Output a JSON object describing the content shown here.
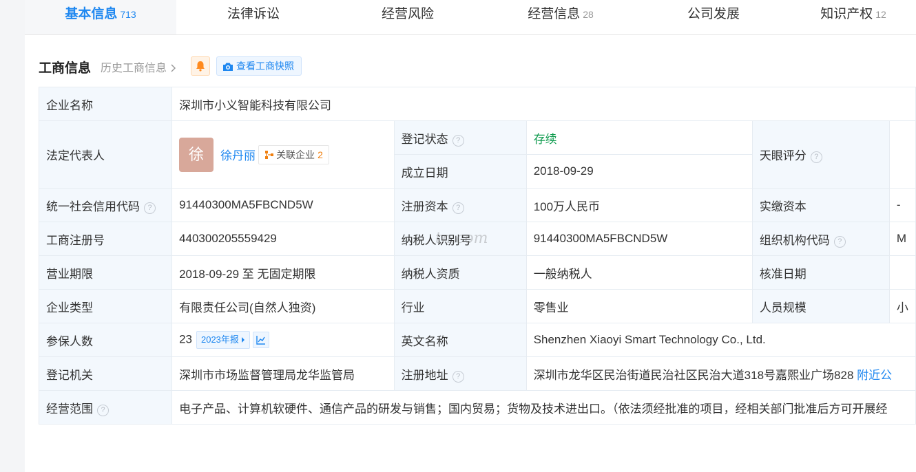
{
  "tabs": [
    {
      "label": "基本信息",
      "count": "713"
    },
    {
      "label": "法律诉讼",
      "count": ""
    },
    {
      "label": "经营风险",
      "count": ""
    },
    {
      "label": "经营信息",
      "count": "28"
    },
    {
      "label": "公司发展",
      "count": ""
    },
    {
      "label": "知识产权",
      "count": "12"
    }
  ],
  "section": {
    "title": "工商信息",
    "history_link": "历史工商信息",
    "snapshot_button": "查看工商快照"
  },
  "company": {
    "name_label": "企业名称",
    "name": "深圳市小义智能科技有限公司",
    "legal_rep_label": "法定代表人",
    "avatar_char": "徐",
    "legal_rep": "徐丹丽",
    "related_label": "关联企业",
    "related_count": "2",
    "status_label": "登记状态",
    "status": "存续",
    "founded_label": "成立日期",
    "founded": "2018-09-29",
    "score_label": "天眼评分",
    "credit_code_label": "统一社会信用代码",
    "credit_code": "91440300MA5FBCND5W",
    "reg_capital_label": "注册资本",
    "reg_capital": "100万人民币",
    "paid_capital_label": "实缴资本",
    "paid_capital": "-",
    "reg_no_label": "工商注册号",
    "reg_no": "440300205559429",
    "taxpayer_id_label": "纳税人识别号",
    "taxpayer_id": "91440300MA5FBCND5W",
    "org_code_label": "组织机构代码",
    "org_code": "M",
    "term_label": "营业期限",
    "term": "2018-09-29 至 无固定期限",
    "tax_qual_label": "纳税人资质",
    "tax_qual": "一般纳税人",
    "approved_label": "核准日期",
    "type_label": "企业类型",
    "type": "有限责任公司(自然人独资)",
    "industry_label": "行业",
    "industry": "零售业",
    "staff_label": "人员规模",
    "staff": "小",
    "insured_label": "参保人数",
    "insured": "23",
    "report_year": "2023年报",
    "en_name_label": "英文名称",
    "en_name": "Shenzhen Xiaoyi Smart Technology Co., Ltd.",
    "authority_label": "登记机关",
    "authority": "深圳市市场监督管理局龙华监管局",
    "address_label": "注册地址",
    "address": "深圳市龙华区民治街道民治社区民治大道318号嘉熙业广场828",
    "nearby_link": "附近公",
    "scope_label": "经营范围",
    "scope": "电子产品、计算机软硬件、通信产品的研发与销售；国内贸易；货物及技术进出口。（依法须经批准的项目，经相关部门批准后方可开展经"
  },
  "watermark": "tn.com",
  "colors": {
    "accent": "#1e87f0",
    "status": "#0c9a4c",
    "label_bg": "#f3f8fd"
  }
}
